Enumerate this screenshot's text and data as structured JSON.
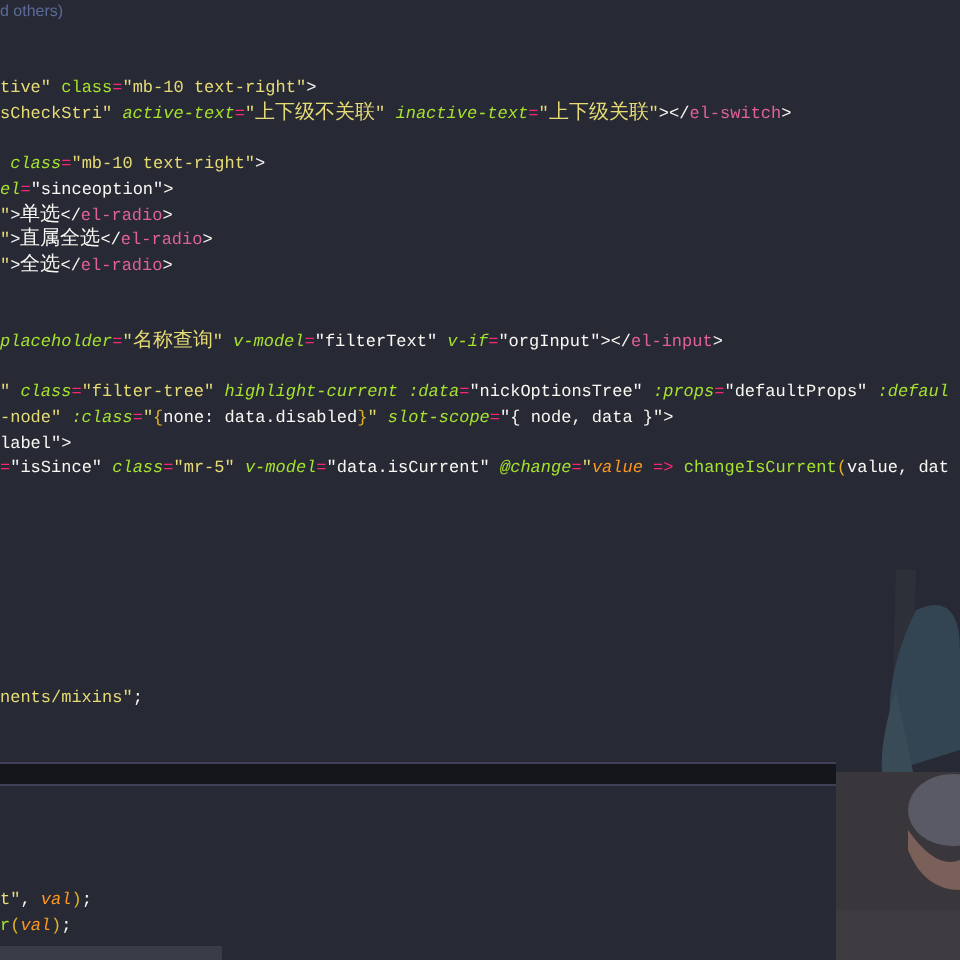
{
  "editor": {
    "lines": [
      {
        "tokens": [
          {
            "text": "d others)",
            "kind": "comment"
          }
        ]
      },
      {
        "current": false
      },
      {
        "current": false
      },
      {
        "tokens": [
          {
            "text": "tive\"",
            "kind": "str"
          },
          {
            "text": " class",
            "kind": "attr"
          },
          {
            "text": "=",
            "kind": "op"
          },
          {
            "text": "\"mb-10 text-right\"",
            "kind": "str"
          },
          {
            "text": ">",
            "kind": "punct"
          }
        ]
      },
      {
        "tokens": [
          {
            "text": "sCheckStri\"",
            "kind": "str"
          },
          {
            "text": " active-text",
            "kind": "attr_i"
          },
          {
            "text": "=",
            "kind": "op"
          },
          {
            "text": "\"",
            "kind": "str"
          },
          {
            "text": "上下级不关联",
            "kind": "cjk_str"
          },
          {
            "text": "\"",
            "kind": "str"
          },
          {
            "text": " inactive-text",
            "kind": "attr_i"
          },
          {
            "text": "=",
            "kind": "op"
          },
          {
            "text": "\"",
            "kind": "str"
          },
          {
            "text": "上下级关联",
            "kind": "cjk_str"
          },
          {
            "text": "\"",
            "kind": "str"
          },
          {
            "text": "></",
            "kind": "punct"
          },
          {
            "text": "el-switch",
            "kind": "tag"
          },
          {
            "text": ">",
            "kind": "punct"
          }
        ]
      },
      {
        "current": false
      },
      {
        "tokens": [
          {
            "text": " class",
            "kind": "attr_i"
          },
          {
            "text": "=",
            "kind": "op"
          },
          {
            "text": "\"mb-10 text-right\"",
            "kind": "str"
          },
          {
            "text": ">",
            "kind": "punct"
          }
        ]
      },
      {
        "tokens": [
          {
            "text": "el",
            "kind": "attr_i"
          },
          {
            "text": "=",
            "kind": "op"
          },
          {
            "text": "\"sinceoption\"",
            "kind": "val"
          },
          {
            "text": ">",
            "kind": "punct"
          }
        ]
      },
      {
        "tokens": [
          {
            "text": "\"",
            "kind": "str"
          },
          {
            "text": ">",
            "kind": "punct"
          },
          {
            "text": "单选",
            "kind": "cjk"
          },
          {
            "text": "</",
            "kind": "punct"
          },
          {
            "text": "el-radio",
            "kind": "tag"
          },
          {
            "text": ">",
            "kind": "punct"
          }
        ]
      },
      {
        "tokens": [
          {
            "text": "\"",
            "kind": "str"
          },
          {
            "text": ">",
            "kind": "punct"
          },
          {
            "text": "直属全选",
            "kind": "cjk"
          },
          {
            "text": "</",
            "kind": "punct"
          },
          {
            "text": "el-radio",
            "kind": "tag"
          },
          {
            "text": ">",
            "kind": "punct"
          }
        ]
      },
      {
        "tokens": [
          {
            "text": "\"",
            "kind": "str"
          },
          {
            "text": ">",
            "kind": "punct"
          },
          {
            "text": "全选",
            "kind": "cjk"
          },
          {
            "text": "</",
            "kind": "punct"
          },
          {
            "text": "el-radio",
            "kind": "tag"
          },
          {
            "text": ">",
            "kind": "punct"
          }
        ]
      },
      {
        "current": false
      },
      {
        "current": false
      },
      {
        "tokens": [
          {
            "text": "placeholder",
            "kind": "attr_i"
          },
          {
            "text": "=",
            "kind": "op"
          },
          {
            "text": "\"",
            "kind": "str"
          },
          {
            "text": "名称查询",
            "kind": "cjk_str"
          },
          {
            "text": "\"",
            "kind": "str"
          },
          {
            "text": " v-model",
            "kind": "attr_i"
          },
          {
            "text": "=",
            "kind": "op"
          },
          {
            "text": "\"filterText\"",
            "kind": "val"
          },
          {
            "text": " v-if",
            "kind": "attr_i"
          },
          {
            "text": "=",
            "kind": "op"
          },
          {
            "text": "\"orgInput\"",
            "kind": "val"
          },
          {
            "text": "></",
            "kind": "punct"
          },
          {
            "text": "el-input",
            "kind": "tag"
          },
          {
            "text": ">",
            "kind": "punct"
          }
        ]
      },
      {
        "current": false
      },
      {
        "tokens": [
          {
            "text": "\"",
            "kind": "str"
          },
          {
            "text": " class",
            "kind": "attr_i"
          },
          {
            "text": "=",
            "kind": "op"
          },
          {
            "text": "\"filter-tree\"",
            "kind": "str"
          },
          {
            "text": " highlight-current",
            "kind": "attr_i"
          },
          {
            "text": " :data",
            "kind": "attr_i"
          },
          {
            "text": "=",
            "kind": "op"
          },
          {
            "text": "\"nickOptionsTree\"",
            "kind": "val"
          },
          {
            "text": " :props",
            "kind": "attr_i"
          },
          {
            "text": "=",
            "kind": "op"
          },
          {
            "text": "\"defaultProps\"",
            "kind": "val"
          },
          {
            "text": " :defaul",
            "kind": "attr_i"
          }
        ]
      },
      {
        "tokens": [
          {
            "text": "-node\"",
            "kind": "str"
          },
          {
            "text": " :class",
            "kind": "attr_i"
          },
          {
            "text": "=",
            "kind": "op"
          },
          {
            "text": "\"",
            "kind": "str"
          },
          {
            "text": "{",
            "kind": "brace"
          },
          {
            "text": "none: data.disabled",
            "kind": "val"
          },
          {
            "text": "}",
            "kind": "brace"
          },
          {
            "text": "\"",
            "kind": "str"
          },
          {
            "text": " slot-scope",
            "kind": "attr_i"
          },
          {
            "text": "=",
            "kind": "op"
          },
          {
            "text": "\"{ node, data }\"",
            "kind": "val"
          },
          {
            "text": ">",
            "kind": "punct"
          }
        ]
      },
      {
        "tokens": [
          {
            "text": "label\"",
            "kind": "val"
          },
          {
            "text": ">",
            "kind": "punct"
          }
        ]
      },
      {
        "tokens": [
          {
            "text": "=",
            "kind": "op"
          },
          {
            "text": "\"isSince\"",
            "kind": "val"
          },
          {
            "text": " class",
            "kind": "attr_i"
          },
          {
            "text": "=",
            "kind": "op"
          },
          {
            "text": "\"mr-5\"",
            "kind": "str"
          },
          {
            "text": " v-model",
            "kind": "attr_i"
          },
          {
            "text": "=",
            "kind": "op"
          },
          {
            "text": "\"data.isCurrent\"",
            "kind": "val"
          },
          {
            "text": " @change",
            "kind": "attr_i"
          },
          {
            "text": "=",
            "kind": "op"
          },
          {
            "text": "\"",
            "kind": "str"
          },
          {
            "text": "value",
            "kind": "param"
          },
          {
            "text": " =>",
            "kind": "op"
          },
          {
            "text": " changeIsCurrent",
            "kind": "fn"
          },
          {
            "text": "(",
            "kind": "brace"
          },
          {
            "text": "value, dat",
            "kind": "val"
          }
        ]
      },
      {
        "current": false
      },
      {
        "current": false
      },
      {
        "current": false
      },
      {
        "current": false
      },
      {
        "current": false
      },
      {
        "current": false
      },
      {
        "current": false
      },
      {
        "current": false
      },
      {
        "tokens": [
          {
            "text": "nents/mixins\"",
            "kind": "str"
          },
          {
            "text": ";",
            "kind": "punct"
          }
        ]
      },
      {
        "current": false
      },
      {
        "current": false
      },
      {
        "current": true
      },
      {
        "current": false
      },
      {
        "current": false
      },
      {
        "current": false
      },
      {
        "current": false
      },
      {
        "tokens": [
          {
            "text": "t\"",
            "kind": "str"
          },
          {
            "text": ", ",
            "kind": "punct"
          },
          {
            "text": "val",
            "kind": "param"
          },
          {
            "text": ")",
            "kind": "brace"
          },
          {
            "text": ";",
            "kind": "punct"
          }
        ]
      },
      {
        "tokens": [
          {
            "text": "r",
            "kind": "fn"
          },
          {
            "text": "(",
            "kind": "brace"
          },
          {
            "text": "val",
            "kind": "param"
          },
          {
            "text": ")",
            "kind": "brace"
          },
          {
            "text": ";",
            "kind": "punct"
          }
        ]
      }
    ]
  }
}
